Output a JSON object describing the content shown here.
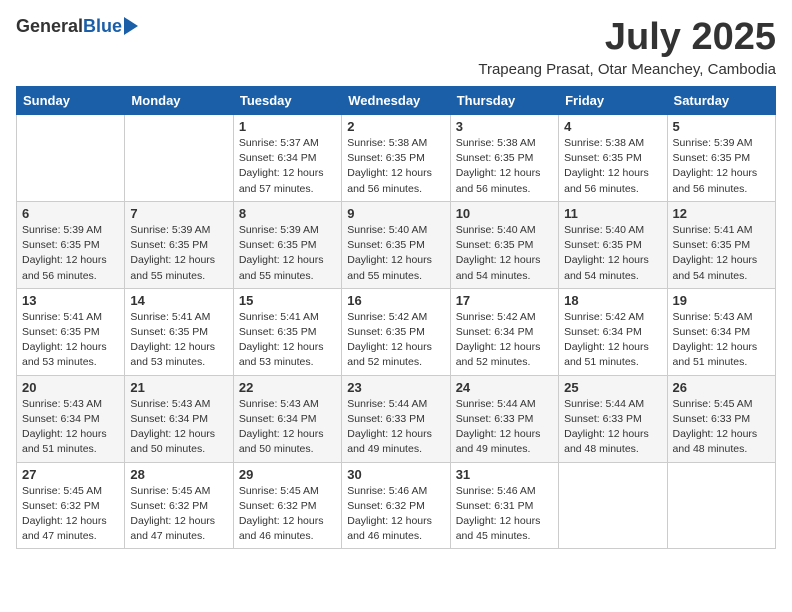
{
  "header": {
    "logo_general": "General",
    "logo_blue": "Blue",
    "month_year": "July 2025",
    "location": "Trapeang Prasat, Otar Meanchey, Cambodia"
  },
  "days_of_week": [
    "Sunday",
    "Monday",
    "Tuesday",
    "Wednesday",
    "Thursday",
    "Friday",
    "Saturday"
  ],
  "weeks": [
    [
      {
        "day": "",
        "info": ""
      },
      {
        "day": "",
        "info": ""
      },
      {
        "day": "1",
        "info": "Sunrise: 5:37 AM\nSunset: 6:34 PM\nDaylight: 12 hours and 57 minutes."
      },
      {
        "day": "2",
        "info": "Sunrise: 5:38 AM\nSunset: 6:35 PM\nDaylight: 12 hours and 56 minutes."
      },
      {
        "day": "3",
        "info": "Sunrise: 5:38 AM\nSunset: 6:35 PM\nDaylight: 12 hours and 56 minutes."
      },
      {
        "day": "4",
        "info": "Sunrise: 5:38 AM\nSunset: 6:35 PM\nDaylight: 12 hours and 56 minutes."
      },
      {
        "day": "5",
        "info": "Sunrise: 5:39 AM\nSunset: 6:35 PM\nDaylight: 12 hours and 56 minutes."
      }
    ],
    [
      {
        "day": "6",
        "info": "Sunrise: 5:39 AM\nSunset: 6:35 PM\nDaylight: 12 hours and 56 minutes."
      },
      {
        "day": "7",
        "info": "Sunrise: 5:39 AM\nSunset: 6:35 PM\nDaylight: 12 hours and 55 minutes."
      },
      {
        "day": "8",
        "info": "Sunrise: 5:39 AM\nSunset: 6:35 PM\nDaylight: 12 hours and 55 minutes."
      },
      {
        "day": "9",
        "info": "Sunrise: 5:40 AM\nSunset: 6:35 PM\nDaylight: 12 hours and 55 minutes."
      },
      {
        "day": "10",
        "info": "Sunrise: 5:40 AM\nSunset: 6:35 PM\nDaylight: 12 hours and 54 minutes."
      },
      {
        "day": "11",
        "info": "Sunrise: 5:40 AM\nSunset: 6:35 PM\nDaylight: 12 hours and 54 minutes."
      },
      {
        "day": "12",
        "info": "Sunrise: 5:41 AM\nSunset: 6:35 PM\nDaylight: 12 hours and 54 minutes."
      }
    ],
    [
      {
        "day": "13",
        "info": "Sunrise: 5:41 AM\nSunset: 6:35 PM\nDaylight: 12 hours and 53 minutes."
      },
      {
        "day": "14",
        "info": "Sunrise: 5:41 AM\nSunset: 6:35 PM\nDaylight: 12 hours and 53 minutes."
      },
      {
        "day": "15",
        "info": "Sunrise: 5:41 AM\nSunset: 6:35 PM\nDaylight: 12 hours and 53 minutes."
      },
      {
        "day": "16",
        "info": "Sunrise: 5:42 AM\nSunset: 6:35 PM\nDaylight: 12 hours and 52 minutes."
      },
      {
        "day": "17",
        "info": "Sunrise: 5:42 AM\nSunset: 6:34 PM\nDaylight: 12 hours and 52 minutes."
      },
      {
        "day": "18",
        "info": "Sunrise: 5:42 AM\nSunset: 6:34 PM\nDaylight: 12 hours and 51 minutes."
      },
      {
        "day": "19",
        "info": "Sunrise: 5:43 AM\nSunset: 6:34 PM\nDaylight: 12 hours and 51 minutes."
      }
    ],
    [
      {
        "day": "20",
        "info": "Sunrise: 5:43 AM\nSunset: 6:34 PM\nDaylight: 12 hours and 51 minutes."
      },
      {
        "day": "21",
        "info": "Sunrise: 5:43 AM\nSunset: 6:34 PM\nDaylight: 12 hours and 50 minutes."
      },
      {
        "day": "22",
        "info": "Sunrise: 5:43 AM\nSunset: 6:34 PM\nDaylight: 12 hours and 50 minutes."
      },
      {
        "day": "23",
        "info": "Sunrise: 5:44 AM\nSunset: 6:33 PM\nDaylight: 12 hours and 49 minutes."
      },
      {
        "day": "24",
        "info": "Sunrise: 5:44 AM\nSunset: 6:33 PM\nDaylight: 12 hours and 49 minutes."
      },
      {
        "day": "25",
        "info": "Sunrise: 5:44 AM\nSunset: 6:33 PM\nDaylight: 12 hours and 48 minutes."
      },
      {
        "day": "26",
        "info": "Sunrise: 5:45 AM\nSunset: 6:33 PM\nDaylight: 12 hours and 48 minutes."
      }
    ],
    [
      {
        "day": "27",
        "info": "Sunrise: 5:45 AM\nSunset: 6:32 PM\nDaylight: 12 hours and 47 minutes."
      },
      {
        "day": "28",
        "info": "Sunrise: 5:45 AM\nSunset: 6:32 PM\nDaylight: 12 hours and 47 minutes."
      },
      {
        "day": "29",
        "info": "Sunrise: 5:45 AM\nSunset: 6:32 PM\nDaylight: 12 hours and 46 minutes."
      },
      {
        "day": "30",
        "info": "Sunrise: 5:46 AM\nSunset: 6:32 PM\nDaylight: 12 hours and 46 minutes."
      },
      {
        "day": "31",
        "info": "Sunrise: 5:46 AM\nSunset: 6:31 PM\nDaylight: 12 hours and 45 minutes."
      },
      {
        "day": "",
        "info": ""
      },
      {
        "day": "",
        "info": ""
      }
    ]
  ]
}
